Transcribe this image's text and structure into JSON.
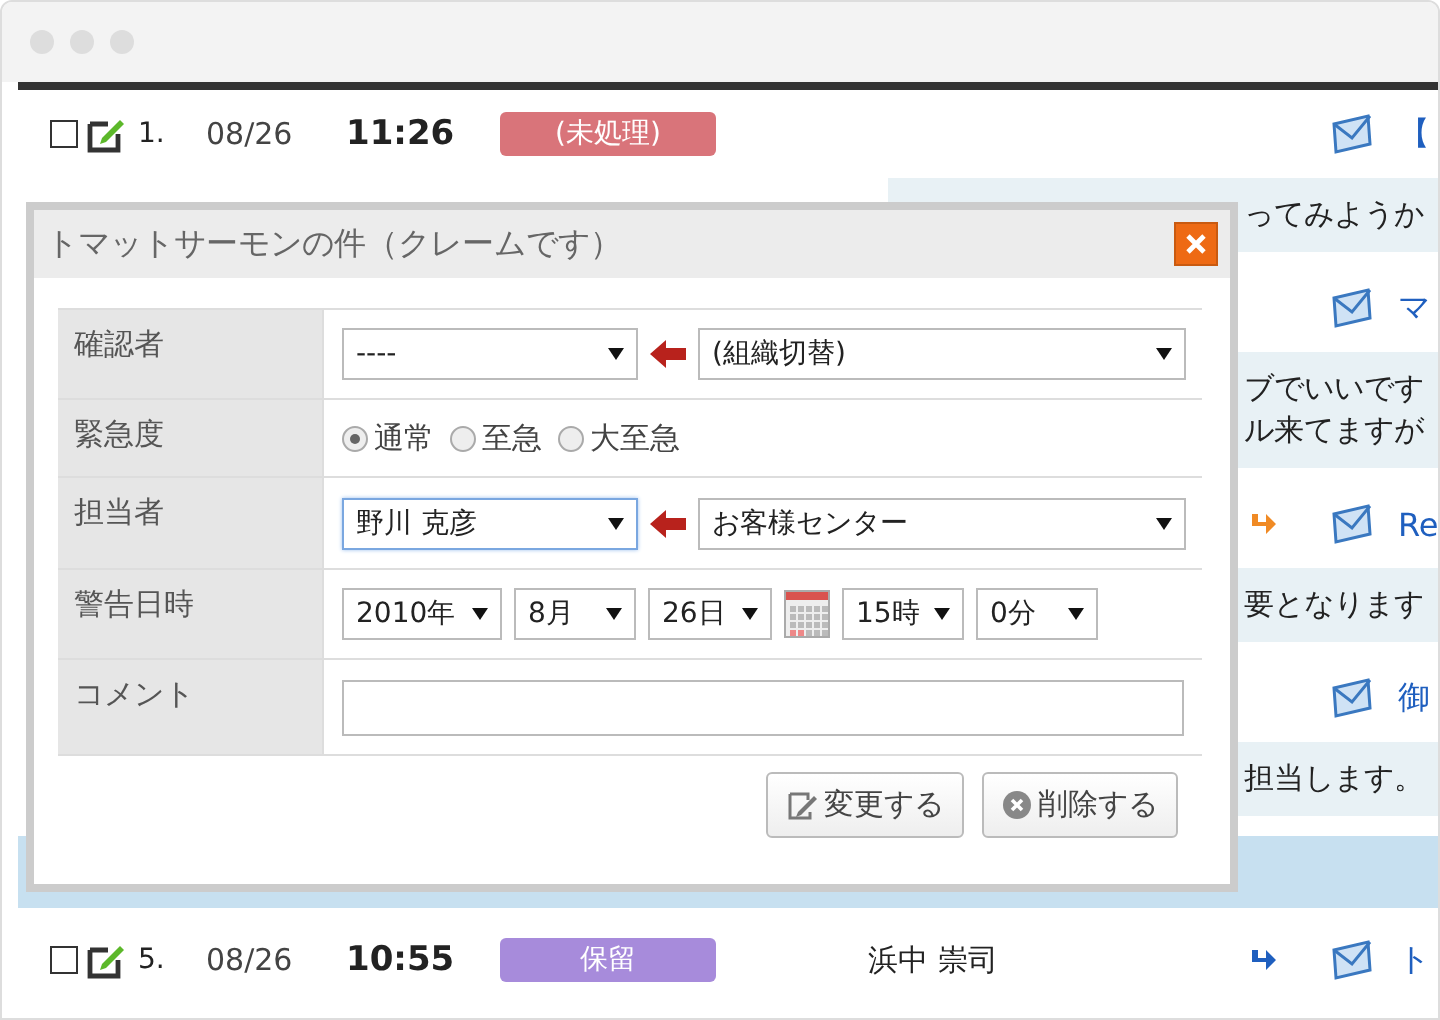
{
  "rows": [
    {
      "checked": false,
      "number": "1.",
      "date": "08/26",
      "time": "11:26",
      "status": {
        "label": "(未処理)",
        "color": "#d9747a"
      },
      "subject": "【",
      "snippets": [
        "ってみようか"
      ]
    },
    {
      "subject": "マ",
      "snippets": [
        "ブでいいです",
        "ル来てますが"
      ]
    },
    {
      "arrow": {
        "color": "#f08a24"
      },
      "subject": "Re",
      "snippets": [
        "要となります"
      ]
    },
    {
      "subject": "御",
      "snippets": [
        "担当します。"
      ]
    },
    {
      "checked": false,
      "number": "5.",
      "date": "08/26",
      "time": "10:55",
      "status": {
        "label": "保留",
        "color": "#a78bdb"
      },
      "assignee": "浜中 崇司",
      "arrow": {
        "color": "#1f5fbf"
      },
      "subject": "ト"
    }
  ],
  "modal": {
    "title": "トマットサーモンの件（クレームです）",
    "fields": [
      {
        "label": "確認者",
        "kind": "select-pair",
        "value": "----",
        "focused": false,
        "group": "(組織切替)"
      },
      {
        "label": "緊急度",
        "kind": "radio",
        "options": [
          {
            "label": "通常",
            "selected": true
          },
          {
            "label": "至急",
            "selected": false
          },
          {
            "label": "大至急",
            "selected": false
          }
        ]
      },
      {
        "label": "担当者",
        "kind": "select-pair",
        "value": "野川 克彦",
        "focused": true,
        "group": "お客様センター"
      },
      {
        "label": "警告日時",
        "kind": "datetime",
        "year": "2010年",
        "month": "8月",
        "day": "26日",
        "hour": "15時",
        "minute": "0分"
      },
      {
        "label": "コメント",
        "kind": "text"
      }
    ],
    "buttons": [
      {
        "label": "変更する",
        "kind": "edit"
      },
      {
        "label": "削除する",
        "kind": "delete"
      }
    ]
  }
}
